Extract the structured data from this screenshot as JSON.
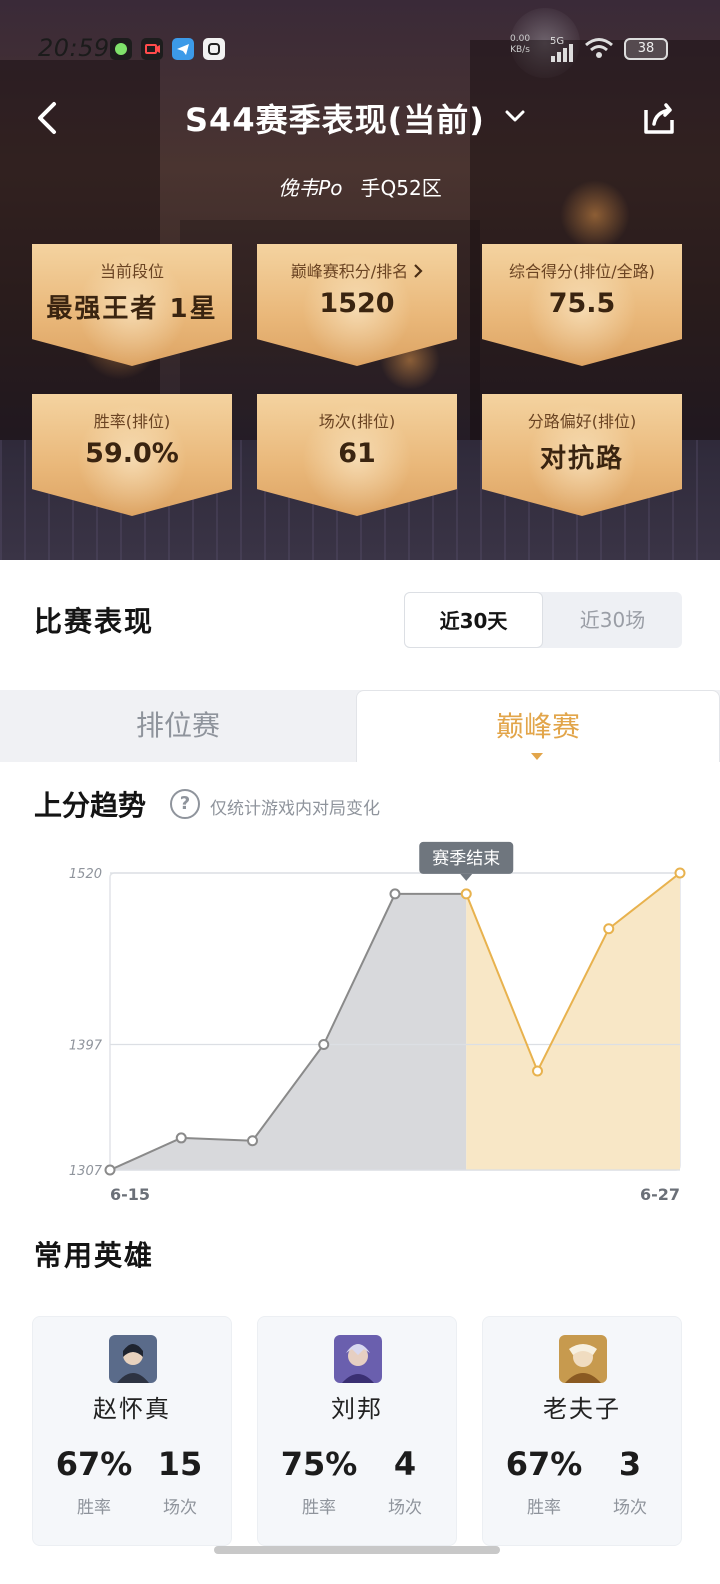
{
  "status_bar": {
    "time": "20:59",
    "net_speed_top": "0.00",
    "net_speed_bottom": "KB/s",
    "signal": "5G",
    "battery": "38"
  },
  "nav": {
    "title": "S44赛季表现(当前)"
  },
  "player": {
    "name": "俛韦Po",
    "zone": "手Q52区"
  },
  "stats": [
    {
      "label": "当前段位",
      "value": "最强王者 1星"
    },
    {
      "label": "巅峰赛积分/排名",
      "value": "1520"
    },
    {
      "label": "综合得分(排位/全路)",
      "value": "75.5"
    },
    {
      "label": "胜率(排位)",
      "value": "59.0%"
    },
    {
      "label": "场次(排位)",
      "value": "61"
    },
    {
      "label": "分路偏好(排位)",
      "value": "对抗路"
    }
  ],
  "performance": {
    "title": "比赛表现",
    "range_options": [
      "近30天",
      "近30场"
    ],
    "selected_range": "近30天",
    "tabs": [
      "排位赛",
      "巅峰赛"
    ],
    "selected_tab": "巅峰赛"
  },
  "trend": {
    "title": "上分趋势",
    "help_glyph": "?",
    "note": "仅统计游戏内对局变化"
  },
  "chart_data": {
    "type": "area",
    "title": "上分趋势",
    "x_start_label": "6-15",
    "x_end_label": "6-27",
    "yticks": [
      "1520",
      "1397",
      "1307"
    ],
    "ylim": [
      1307,
      1520
    ],
    "values": [
      1307,
      1330,
      1328,
      1397,
      1505,
      1505,
      1378,
      1480,
      1520
    ],
    "season_end_index": 5,
    "season_end_label": "赛季结束",
    "colors": {
      "before": "#d8d9dc",
      "after": "#f8e7c6",
      "line_before": "#8a8a8a",
      "line_after": "#e8b24e"
    }
  },
  "heroes": {
    "title": "常用英雄",
    "items": [
      {
        "name": "赵怀真",
        "win_rate": "67%",
        "games": "15",
        "win_label": "胜率",
        "games_label": "场次",
        "avatar_color": "#5a6b8a"
      },
      {
        "name": "刘邦",
        "win_rate": "75%",
        "games": "4",
        "win_label": "胜率",
        "games_label": "场次",
        "avatar_color": "#6a5fae"
      },
      {
        "name": "老夫子",
        "win_rate": "67%",
        "games": "3",
        "win_label": "胜率",
        "games_label": "场次",
        "avatar_color": "#c79a4e"
      }
    ]
  }
}
